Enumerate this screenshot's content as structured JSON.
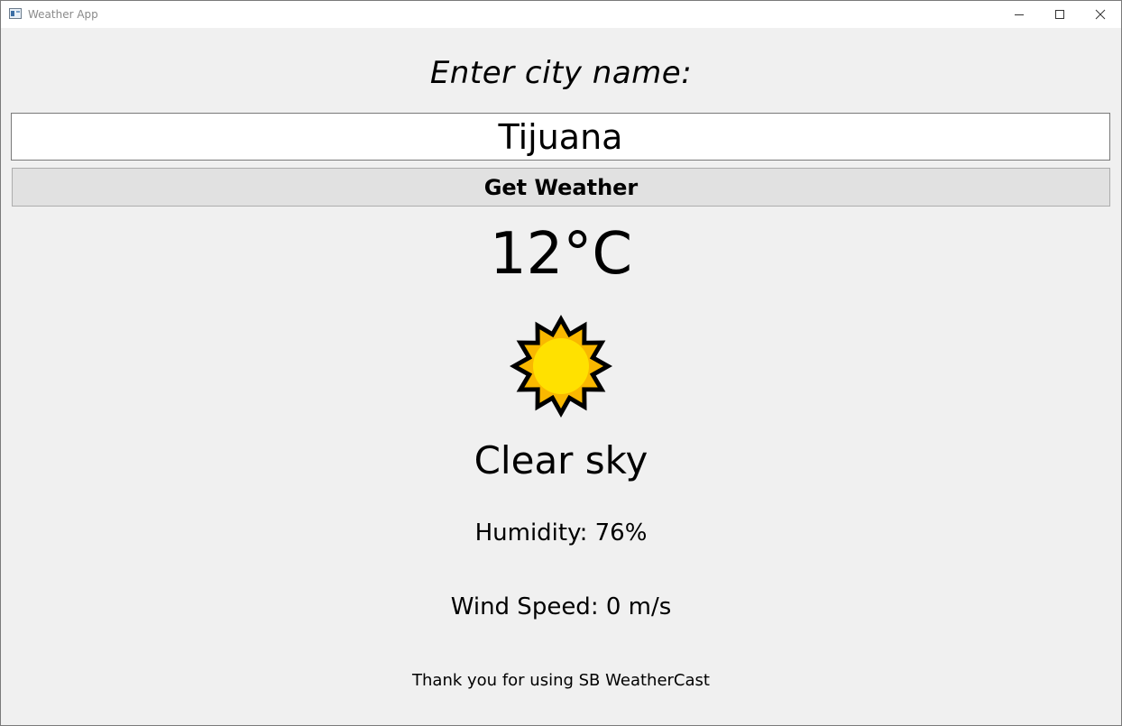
{
  "window": {
    "title": "Weather App",
    "icons": {
      "app": "app-window-icon",
      "minimize": "minimize-icon",
      "maximize": "maximize-icon",
      "close": "close-icon"
    }
  },
  "form": {
    "prompt": "Enter city name:",
    "city_value": "Tijuana",
    "button_label": "Get Weather"
  },
  "weather": {
    "temperature": "12°C",
    "icon": "sun-icon",
    "description": "Clear sky",
    "humidity": "Humidity: 76%",
    "wind_speed": "Wind Speed: 0 m/s"
  },
  "footer": {
    "message": "Thank you for using SB WeatherCast"
  },
  "colors": {
    "background": "#f0f0f0",
    "sun_outline": "#000000",
    "sun_rays": "#f9b800",
    "sun_core": "#ffe100"
  }
}
